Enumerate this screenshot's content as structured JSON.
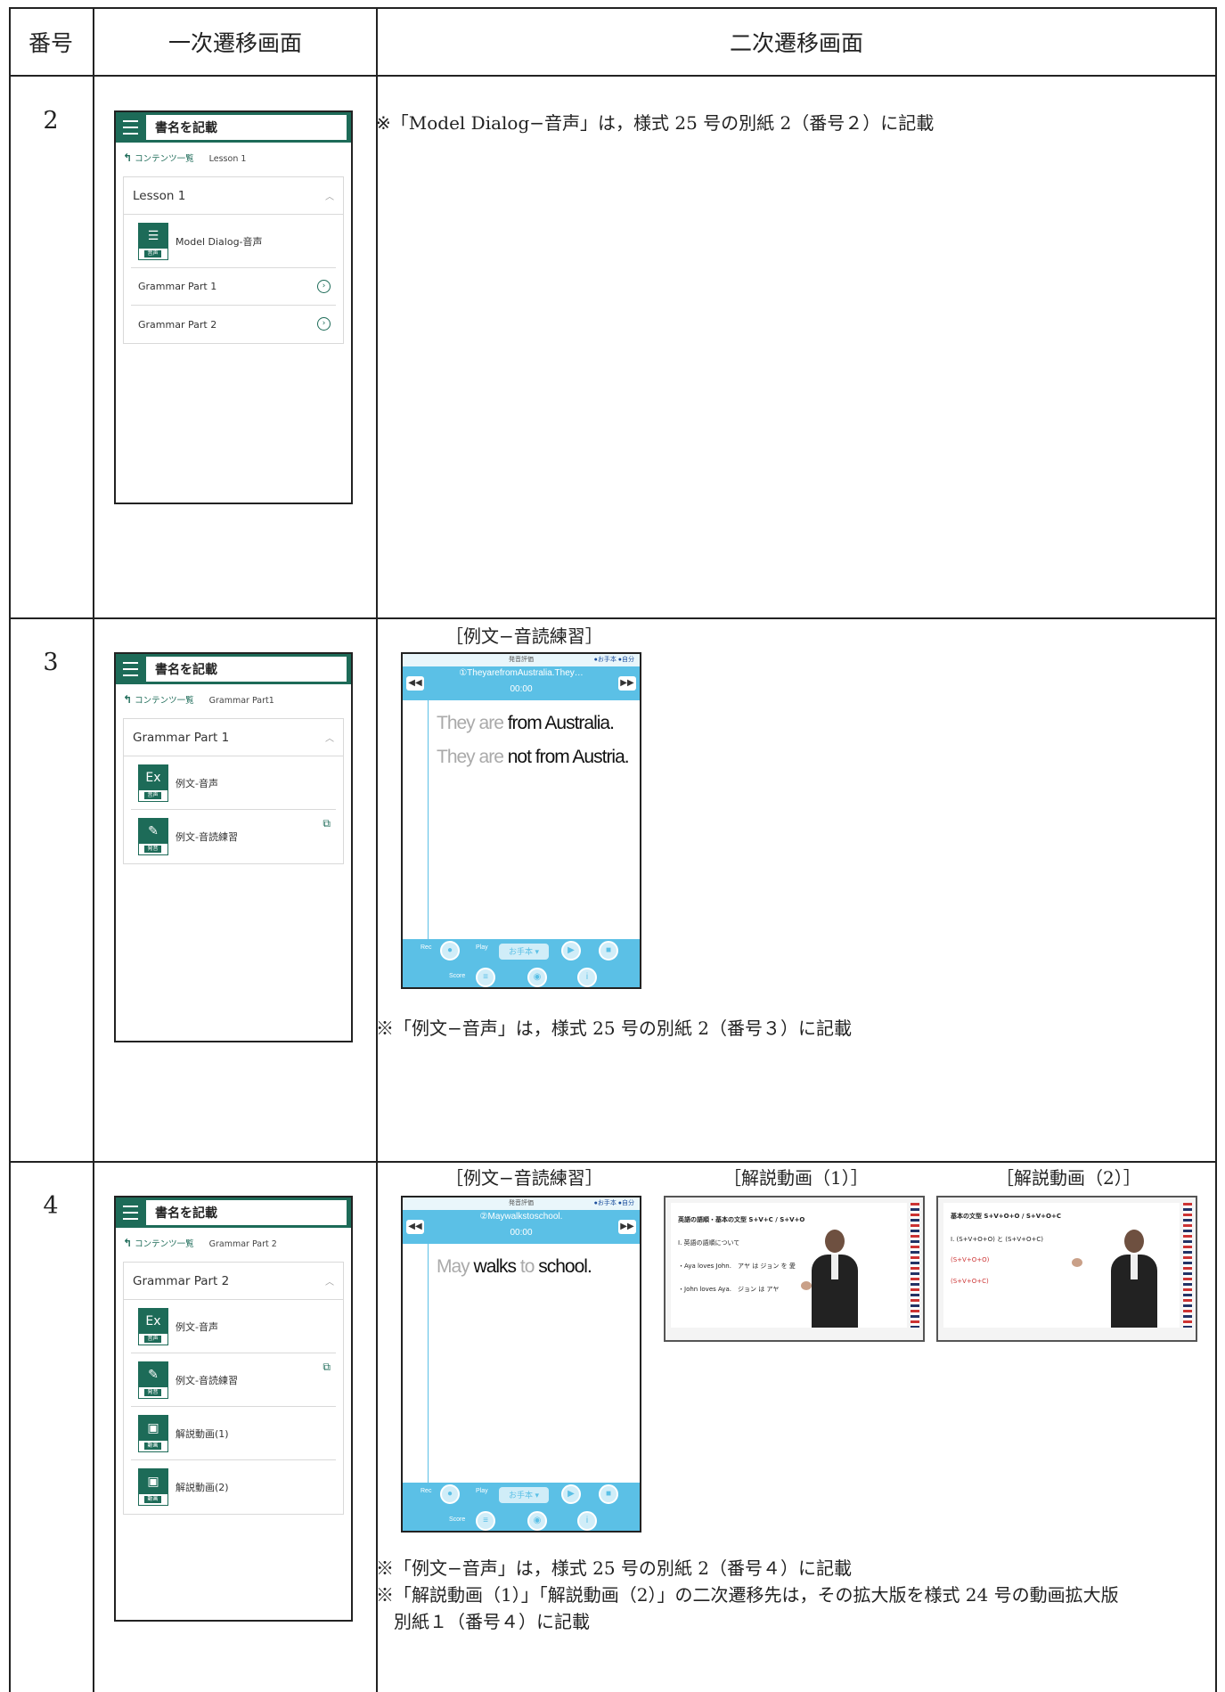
{
  "headers": {
    "number": "番号",
    "primary": "一次遷移画面",
    "secondary": "二次遷移画面"
  },
  "common": {
    "book_title": "書名を記載",
    "crumb_back": "コンテンツ一覧",
    "tag_audio": "音声",
    "tag_pron": "発音",
    "tag_video": "動画"
  },
  "rows": [
    {
      "number": "2",
      "crumb_current": "Lesson 1",
      "card_title": "Lesson 1",
      "items": {
        "model_dialog": "Model Dialog-音声",
        "grammar1": "Grammar Part 1",
        "grammar2": "Grammar Part 2"
      },
      "notes": [
        "※「Model Dialog−音声」は，様式 25 号の別紙 2（番号２）に記載"
      ]
    },
    {
      "number": "3",
      "crumb_current": "Grammar Part1",
      "card_title": "Grammar Part 1",
      "items": {
        "example_audio": "例文-音声",
        "example_reading": "例文-音読練習"
      },
      "caption": "［例文−音読練習］",
      "app": {
        "header": "発音評価",
        "badges": "●お手本 ●自分",
        "title": "①TheyarefromAustralia.They…",
        "time": "00:00",
        "lines": [
          {
            "gray": "They are",
            "black": "from Australia."
          },
          {
            "gray": "They are",
            "black": "not from Austria."
          }
        ],
        "rec": "Rec",
        "play": "Play",
        "score": "Score",
        "select": "お手本 ▾"
      },
      "notes": [
        "※「例文−音声」は，様式 25 号の別紙 2（番号３）に記載"
      ]
    },
    {
      "number": "4",
      "crumb_current": "Grammar Part 2",
      "card_title": "Grammar Part 2",
      "items": {
        "example_audio": "例文-音声",
        "example_reading": "例文-音読練習",
        "video1": "解説動画(1)",
        "video2": "解説動画(2)"
      },
      "captions": [
        "［例文−音読練習］",
        "［解説動画（1）］",
        "［解説動画（2）］"
      ],
      "app": {
        "header": "発音評価",
        "badges": "●お手本 ●自分",
        "title": "②Maywalkstoschool.",
        "time": "00:00",
        "line": {
          "p1_black": "May",
          "p2_gray": " walks",
          "p3_black": " to",
          "p4_black": " school."
        },
        "rec": "Rec",
        "play": "Play",
        "score": "Score",
        "select": "お手本 ▾"
      },
      "video1": {
        "line1": "英語の語順・基本の文型 S+V+C / S+V+O",
        "line2": "Ⅰ. 英語の語順について",
        "line3": "・Aya loves John.　アヤ は ジョン を 愛",
        "line4": "・John loves Aya.　ジョン は アヤ"
      },
      "video2": {
        "line1": "基本の文型 S+V+O+O / S+V+O+C",
        "line2": "Ⅰ. (S+V+O+O) と (S+V+O+C)",
        "line3": "(S+V+O+O)",
        "line4": "(S+V+O+C)"
      },
      "notes": [
        "※「例文−音声」は，様式 25 号の別紙 2（番号４）に記載",
        "※「解説動画（1）」「解説動画（2）」の二次遷移先は，その拡大版を様式 24 号の動画拡大版",
        "別紙１（番号４）に記載"
      ]
    }
  ]
}
